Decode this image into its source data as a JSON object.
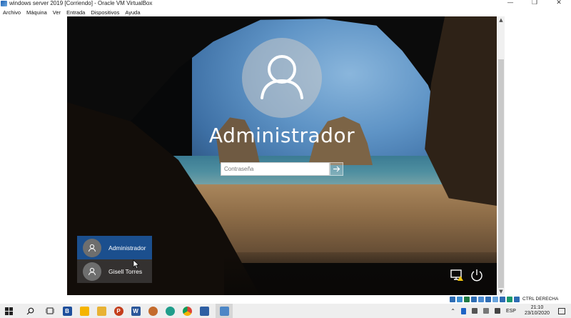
{
  "window": {
    "title": "windows server 2019 [Corriendo] - Oracle VM VirtualBox",
    "minimize_glyph": "—",
    "maximize_glyph": "❐",
    "close_glyph": "✕"
  },
  "menu": {
    "items": [
      "Archivo",
      "Máquina",
      "Ver",
      "Entrada",
      "Dispositivos",
      "Ayuda"
    ]
  },
  "login": {
    "user_name": "Administrador",
    "password_placeholder": "Contraseña",
    "password_value": ""
  },
  "user_list": [
    {
      "name": "Administrador",
      "selected": true
    },
    {
      "name": "Gisell Torres",
      "selected": false
    }
  ],
  "vbox_status": {
    "host_key_label": "CTRL DERECHA"
  },
  "taskbar": {
    "apps": [
      "start",
      "search",
      "task-view",
      "bizagi",
      "sticky",
      "file-explorer",
      "powerpoint",
      "word",
      "paint",
      "edge",
      "chrome",
      "virtualbox",
      "snipping"
    ],
    "tray_lang": "ESP",
    "time": "21:10",
    "date": "23/10/2020"
  },
  "colors": {
    "selected_user": "#1b4f8e",
    "taskbar_bg": "#eeeeee"
  }
}
